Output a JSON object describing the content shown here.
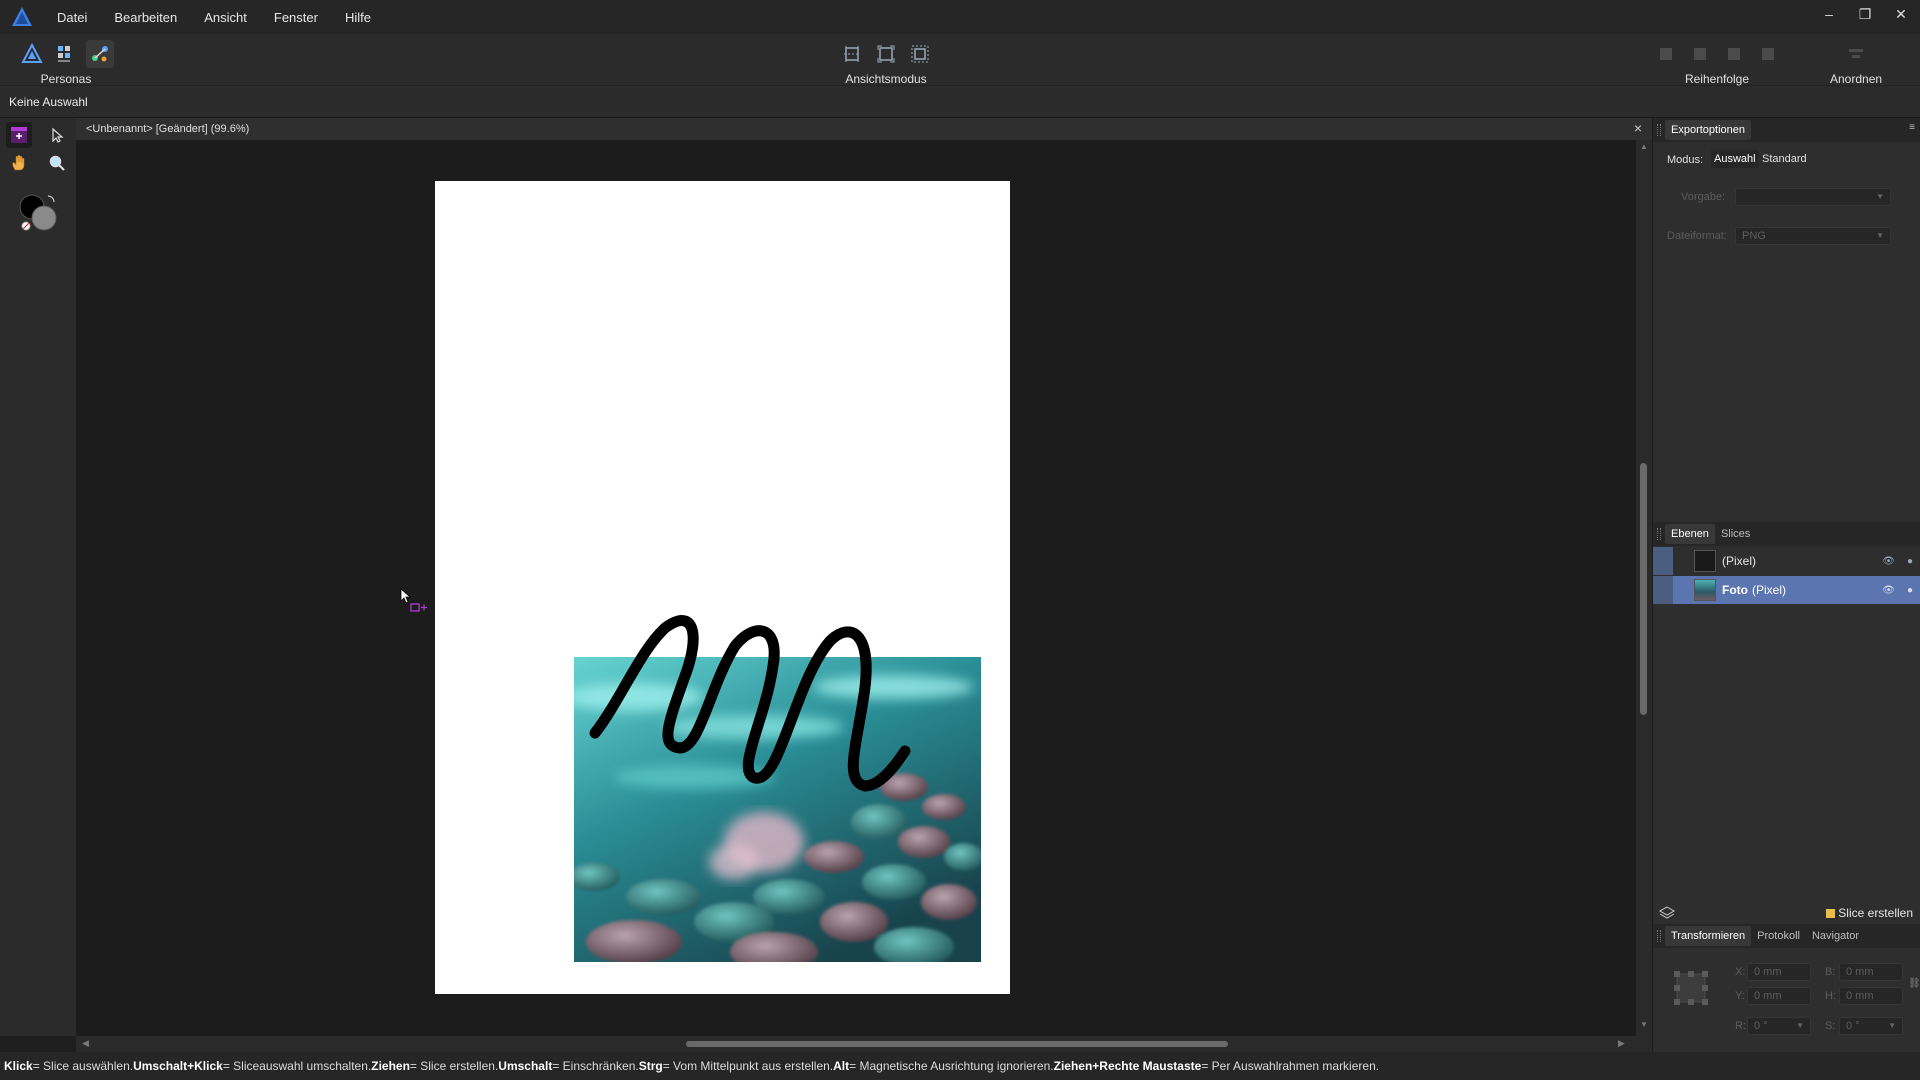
{
  "menu": {
    "items": [
      "Datei",
      "Bearbeiten",
      "Ansicht",
      "Fenster",
      "Hilfe"
    ]
  },
  "window_controls": {
    "minimize": "–",
    "restore": "❐",
    "close": "✕"
  },
  "toolbar": {
    "personas_label": "Personas",
    "view_mode_label": "Ansichtsmodus",
    "order_label": "Reihenfolge",
    "arrange_label": "Anordnen"
  },
  "context": {
    "selection_text": "Keine Auswahl"
  },
  "document": {
    "tab_title": "<Unbenannt> [Geändert] (99.6%)",
    "close": "×"
  },
  "export_panel": {
    "tab_label": "Exportoptionen",
    "mode_label": "Modus:",
    "mode_options": [
      "Auswahl",
      "Standard"
    ],
    "preset_label": "Vorgabe:",
    "preset_value": "",
    "format_label": "Dateiformat:",
    "format_value": "PNG"
  },
  "layers_panel": {
    "tabs": [
      "Ebenen",
      "Slices"
    ],
    "layers": [
      {
        "name": "(Pixel)",
        "selected": false
      },
      {
        "name": "Foto",
        "suffix": "(Pixel)",
        "selected": true
      }
    ]
  },
  "slice_button_label": "Slice erstellen",
  "transform_panel": {
    "tabs": [
      "Transformieren",
      "Protokoll",
      "Navigator"
    ],
    "fields": {
      "x_label": "X:",
      "x_value": "0 mm",
      "b_label": "B:",
      "b_value": "0 mm",
      "y_label": "Y:",
      "y_value": "0 mm",
      "h_label": "H:",
      "h_value": "0 mm",
      "r_label": "R:",
      "r_value": "0 °",
      "s_label": "S:",
      "s_value": "0 °"
    }
  },
  "status": {
    "segments": [
      {
        "key": "Klick",
        "text": " = Slice auswählen. "
      },
      {
        "key": "Umschalt+Klick",
        "text": " = Sliceauswahl umschalten. "
      },
      {
        "key": "Ziehen",
        "text": " = Slice erstellen. "
      },
      {
        "key": "Umschalt",
        "text": " = Einschränken. "
      },
      {
        "key": "Strg",
        "text": " = Vom Mittelpunkt aus erstellen. "
      },
      {
        "key": "Alt",
        "text": " = Magnetische Ausrichtung ignorieren. "
      },
      {
        "key": "Ziehen+Rechte Maustaste",
        "text": " = Per Auswahlrahmen markieren."
      }
    ]
  },
  "colors": {
    "accent_selection": "#4c5e80",
    "slice_tool_accent": "#b03bd1",
    "app_logo": "#3d7fe0"
  },
  "icons": {
    "app_logo": "affinity-logo-icon",
    "personas": [
      "designer-persona-icon",
      "pixel-persona-icon",
      "export-persona-icon"
    ],
    "tools": [
      "slice-tool-icon",
      "slice-select-icon",
      "hand-tool-icon",
      "zoom-tool-icon"
    ]
  }
}
